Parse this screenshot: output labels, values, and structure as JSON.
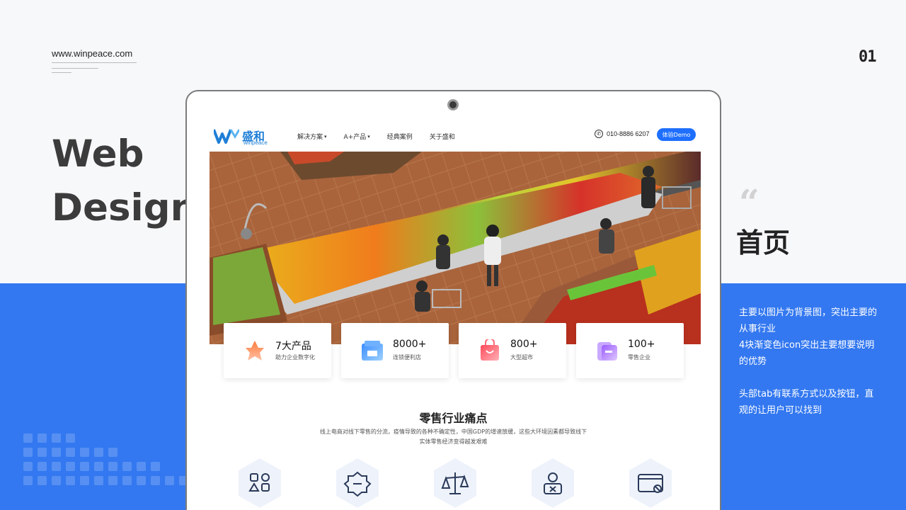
{
  "slide": {
    "url": "www.winpeace.com",
    "page_number": "01",
    "title_line1": "Web",
    "title_line2": "Design",
    "quote_mark": "“",
    "section_title": "首页",
    "description": [
      "主要以图片为背景图，突出主要的从事行业",
      "4块渐变色icon突出主要想要说明的优势",
      "头部tab有联系方式以及按钮，直观的让用户可以找到"
    ]
  },
  "site": {
    "logo_cn": "盛和",
    "logo_en": "winpeace",
    "nav": [
      {
        "label": "解决方案",
        "has_dropdown": true
      },
      {
        "label": "A+产品",
        "has_dropdown": true
      },
      {
        "label": "经典案例",
        "has_dropdown": false
      },
      {
        "label": "关于盛和",
        "has_dropdown": false
      }
    ],
    "phone": "010-8886 6207",
    "demo_button": "体验Demo",
    "stats": [
      {
        "num": "7大产品",
        "label": "助力企业数字化",
        "icon": "star-badge-icon"
      },
      {
        "num": "8000+",
        "label": "连锁便利店",
        "icon": "store-icon"
      },
      {
        "num": "800+",
        "label": "大型超市",
        "icon": "shopping-bag-icon"
      },
      {
        "num": "100+",
        "label": "零售企业",
        "icon": "wallet-icon"
      }
    ],
    "pain_title": "零售行业痛点",
    "pain_desc_line1": "线上电商对线下零售的分流，疫情导致的各种不确定性，中国GDP的增速放缓，这些大环境因素都导致线下",
    "pain_desc_line2": "实体零售经济变得越发艰难",
    "pain_icons": [
      "shapes-icon",
      "badge-minus-icon",
      "scale-icon",
      "user-x-icon",
      "browser-block-icon"
    ]
  },
  "colors": {
    "accent_blue": "#3378f0",
    "button_blue": "#1e6fff",
    "logo_blue": "#1f7fd6"
  }
}
